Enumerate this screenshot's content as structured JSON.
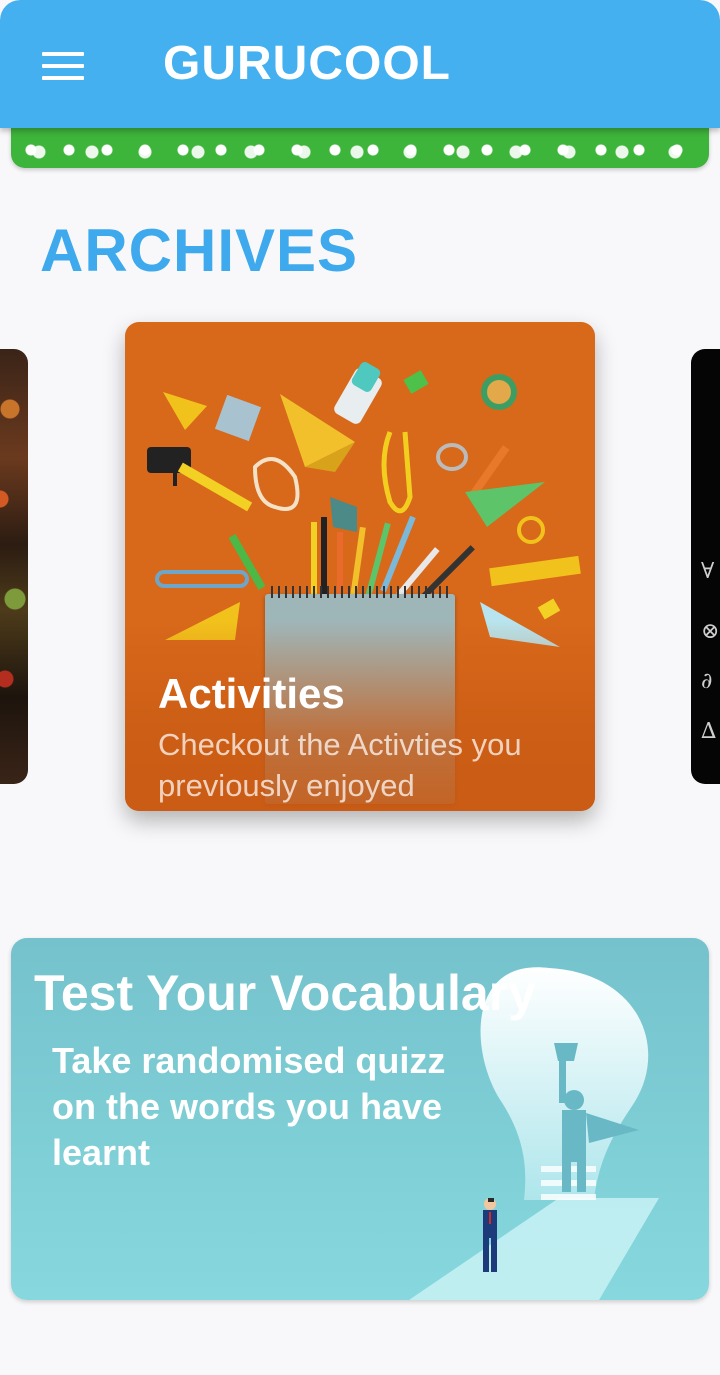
{
  "app": {
    "title": "GURUCOOL"
  },
  "section": {
    "title": "ARCHIVES"
  },
  "carousel": {
    "cards": [
      {
        "title": "Activities",
        "description": "Checkout the Activties you previously enjoyed"
      }
    ]
  },
  "vocab_card": {
    "title": "Test Your Vocabulary",
    "description": "Take randomised quizz on the words you have learnt"
  },
  "colors": {
    "app_bar": "#44b0ef",
    "section_title": "#3ea9ec",
    "activities_card": "#d8681a",
    "vocab_card": "#75c2cc"
  },
  "icons": {
    "menu": "hamburger-menu-icon"
  }
}
